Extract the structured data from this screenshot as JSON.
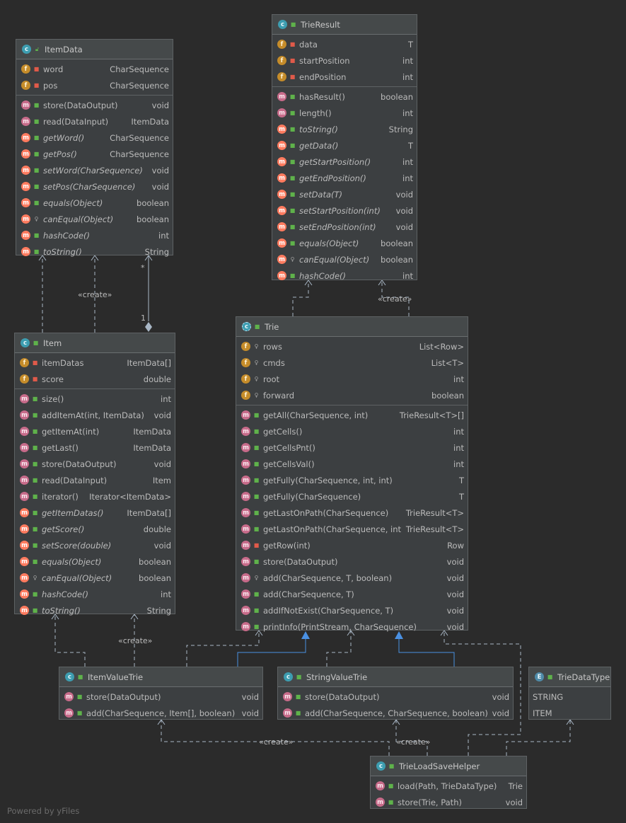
{
  "classes": {
    "itemdata": {
      "name": "ItemData",
      "fields": [
        {
          "name": "word",
          "type": "CharSequence"
        },
        {
          "name": "pos",
          "type": "CharSequence"
        }
      ],
      "methods": [
        {
          "name": "store(DataOutput)",
          "type": "void"
        },
        {
          "name": "read(DataInput)",
          "type": "ItemData"
        },
        {
          "name": "getWord()",
          "type": "CharSequence"
        },
        {
          "name": "getPos()",
          "type": "CharSequence"
        },
        {
          "name": "setWord(CharSequence)",
          "type": "void"
        },
        {
          "name": "setPos(CharSequence)",
          "type": "void"
        },
        {
          "name": "equals(Object)",
          "type": "boolean"
        },
        {
          "name": "canEqual(Object)",
          "type": "boolean"
        },
        {
          "name": "hashCode()",
          "type": "int"
        },
        {
          "name": "toString()",
          "type": "String"
        }
      ]
    },
    "trieresult": {
      "name": "TrieResult",
      "fields": [
        {
          "name": "data",
          "type": "T"
        },
        {
          "name": "startPosition",
          "type": "int"
        },
        {
          "name": "endPosition",
          "type": "int"
        }
      ],
      "methods": [
        {
          "name": "hasResult()",
          "type": "boolean"
        },
        {
          "name": "length()",
          "type": "int"
        },
        {
          "name": "toString()",
          "type": "String"
        },
        {
          "name": "getData()",
          "type": "T"
        },
        {
          "name": "getStartPosition()",
          "type": "int"
        },
        {
          "name": "getEndPosition()",
          "type": "int"
        },
        {
          "name": "setData(T)",
          "type": "void"
        },
        {
          "name": "setStartPosition(int)",
          "type": "void"
        },
        {
          "name": "setEndPosition(int)",
          "type": "void"
        },
        {
          "name": "equals(Object)",
          "type": "boolean"
        },
        {
          "name": "canEqual(Object)",
          "type": "boolean"
        },
        {
          "name": "hashCode()",
          "type": "int"
        }
      ]
    },
    "item": {
      "name": "Item",
      "fields": [
        {
          "name": "itemDatas",
          "type": "ItemData[]"
        },
        {
          "name": "score",
          "type": "double"
        }
      ],
      "methods": [
        {
          "name": "size()",
          "type": "int"
        },
        {
          "name": "addItemAt(int, ItemData)",
          "type": "void"
        },
        {
          "name": "getItemAt(int)",
          "type": "ItemData"
        },
        {
          "name": "getLast()",
          "type": "ItemData"
        },
        {
          "name": "store(DataOutput)",
          "type": "void"
        },
        {
          "name": "read(DataInput)",
          "type": "Item"
        },
        {
          "name": "iterator()",
          "type": "Iterator<ItemData>"
        },
        {
          "name": "getItemDatas()",
          "type": "ItemData[]"
        },
        {
          "name": "getScore()",
          "type": "double"
        },
        {
          "name": "setScore(double)",
          "type": "void"
        },
        {
          "name": "equals(Object)",
          "type": "boolean"
        },
        {
          "name": "canEqual(Object)",
          "type": "boolean"
        },
        {
          "name": "hashCode()",
          "type": "int"
        },
        {
          "name": "toString()",
          "type": "String"
        }
      ]
    },
    "trie": {
      "name": "Trie",
      "fields": [
        {
          "name": "rows",
          "type": "List<Row>"
        },
        {
          "name": "cmds",
          "type": "List<T>"
        },
        {
          "name": "root",
          "type": "int"
        },
        {
          "name": "forward",
          "type": "boolean"
        }
      ],
      "methods": [
        {
          "name": "getAll(CharSequence, int)",
          "type": "TrieResult<T>[]"
        },
        {
          "name": "getCells()",
          "type": "int"
        },
        {
          "name": "getCellsPnt()",
          "type": "int"
        },
        {
          "name": "getCellsVal()",
          "type": "int"
        },
        {
          "name": "getFully(CharSequence, int, int)",
          "type": "T"
        },
        {
          "name": "getFully(CharSequence)",
          "type": "T"
        },
        {
          "name": "getLastOnPath(CharSequence)",
          "type": "TrieResult<T>"
        },
        {
          "name": "getLastOnPath(CharSequence, int)",
          "type": "TrieResult<T>"
        },
        {
          "name": "getRow(int)",
          "type": "Row"
        },
        {
          "name": "store(DataOutput)",
          "type": "void"
        },
        {
          "name": "add(CharSequence, T, boolean)",
          "type": "void"
        },
        {
          "name": "add(CharSequence, T)",
          "type": "void"
        },
        {
          "name": "addIfNotExist(CharSequence, T)",
          "type": "void"
        },
        {
          "name": "printInfo(PrintStream, CharSequence)",
          "type": "void"
        }
      ]
    },
    "itemvaluetrie": {
      "name": "ItemValueTrie",
      "methods": [
        {
          "name": "store(DataOutput)",
          "type": "void"
        },
        {
          "name": "add(CharSequence, Item[], boolean)",
          "type": "void"
        }
      ]
    },
    "stringvaluetrie": {
      "name": "StringValueTrie",
      "methods": [
        {
          "name": "store(DataOutput)",
          "type": "void"
        },
        {
          "name": "add(CharSequence, CharSequence, boolean)",
          "type": "void"
        }
      ]
    },
    "triedatatype": {
      "name": "TrieDataType",
      "constants": [
        "STRING",
        "ITEM"
      ]
    },
    "trieloadsavehelper": {
      "name": "TrieLoadSaveHelper",
      "methods": [
        {
          "name": "load(Path, TrieDataType)",
          "type": "Trie"
        },
        {
          "name": "store(Trie, Path)",
          "type": "void"
        }
      ]
    }
  },
  "labels": {
    "create": "«create»",
    "mult_many": "*",
    "mult_one": "1"
  },
  "footer": "Powered by yFiles",
  "colors": {
    "background": "#2b2b2b",
    "box": "#3c3f41",
    "edge": "#a9b7c6",
    "inheritance": "#4a90e2"
  }
}
